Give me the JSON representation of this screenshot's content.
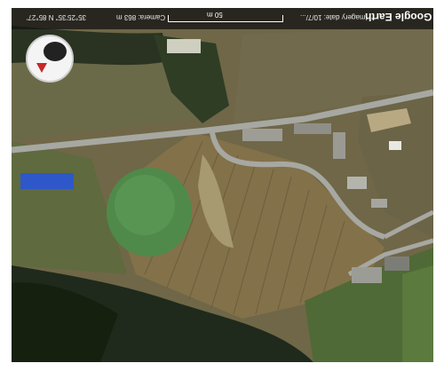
{
  "app": {
    "brand": "Google Earth"
  },
  "status": {
    "imagery_date": "Imagery date: 10/7/...",
    "camera": "Camera: 863 m",
    "coordinates": "35°25'35\" N 85°27'",
    "scale_label": "50 m"
  },
  "icons": {
    "navigation": "compass-navigation-icon",
    "pin": "red-pin-icon"
  },
  "colors": {
    "field": "#6f6747",
    "forest": "#1f2a1c",
    "road": "#a7a8a2",
    "pond": "#4f8a4a",
    "roof_blue": "#2e58c9",
    "bar": "#141414"
  }
}
